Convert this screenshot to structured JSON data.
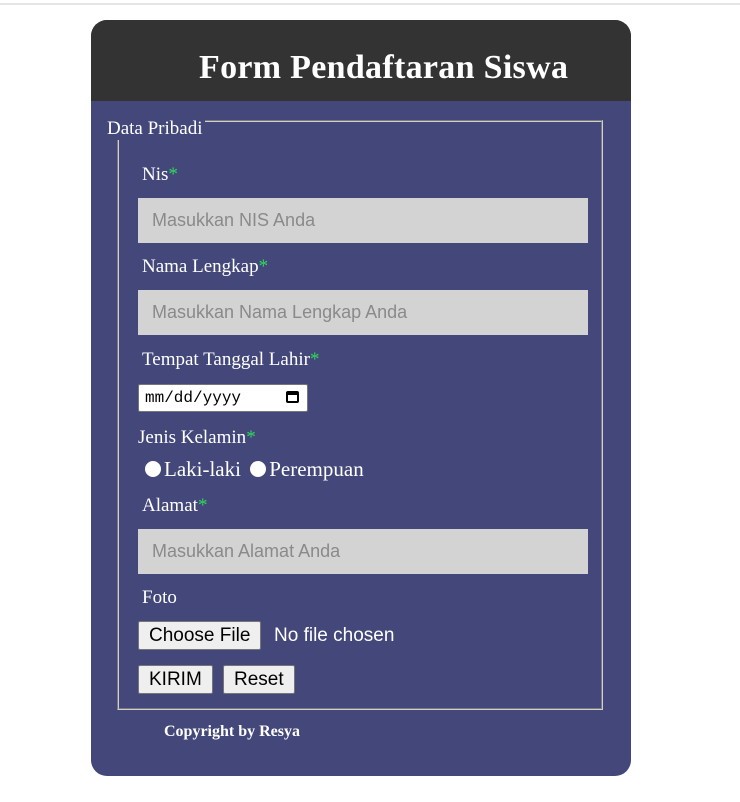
{
  "header": {
    "title": "Form Pendaftaran Siswa"
  },
  "fieldset": {
    "legend": "Data Pribadi"
  },
  "required_mark": "*",
  "fields": {
    "nis": {
      "label": "Nis",
      "placeholder": "Masukkan NIS Anda"
    },
    "nama": {
      "label": "Nama Lengkap",
      "placeholder": "Masukkan Nama Lengkap Anda"
    },
    "ttl": {
      "label": "Tempat Tanggal Lahir",
      "date_placeholder": "mm/dd/yyyy"
    },
    "jenis_kelamin": {
      "label": "Jenis Kelamin",
      "options": [
        "Laki-laki",
        "Perempuan"
      ]
    },
    "alamat": {
      "label": "Alamat",
      "placeholder": "Masukkan Alamat Anda"
    },
    "foto": {
      "label": "Foto",
      "button": "Choose File",
      "status": "No file chosen"
    }
  },
  "buttons": {
    "submit": "KIRIM",
    "reset": "Reset"
  },
  "footer": {
    "copyright": "Copyright by Resya"
  },
  "colors": {
    "card_bg": "#43477a",
    "header_bg": "#333333",
    "input_bg": "#d3d3d3",
    "required": "#2ed95a"
  }
}
